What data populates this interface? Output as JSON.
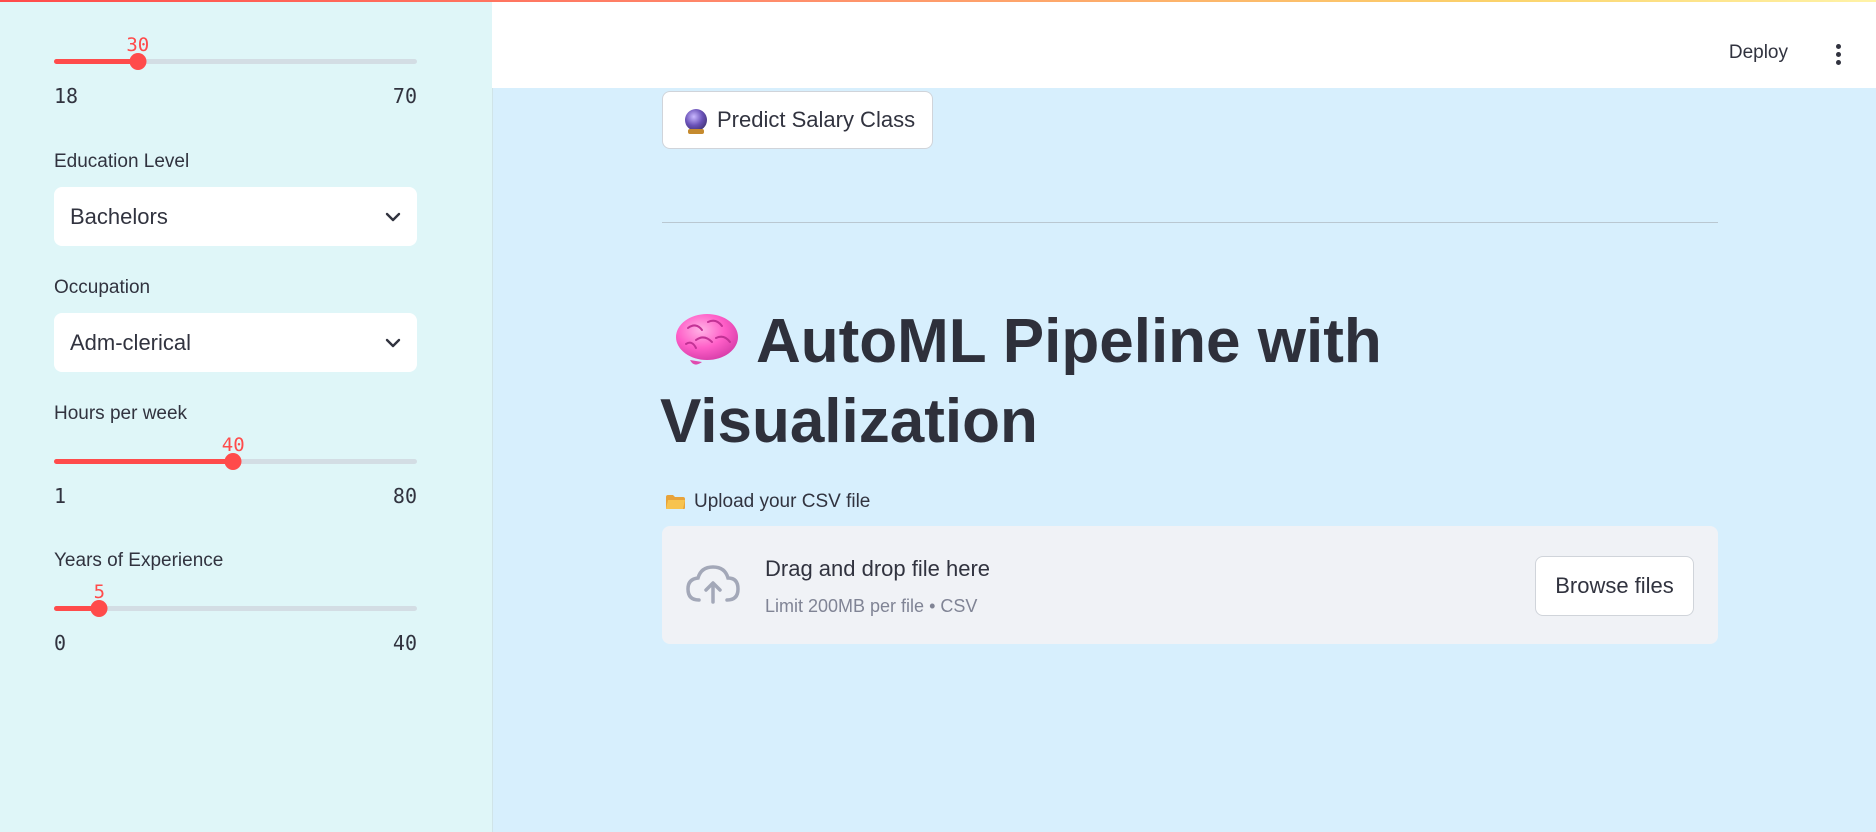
{
  "colors": {
    "accent": "#ff4b4b",
    "main_background": "#d7effd",
    "sidebar_background": "#dff6f8",
    "dropzone_background": "#f0f2f6",
    "text": "#31333f",
    "muted_text": "#808495"
  },
  "sidebar": {
    "age_slider": {
      "value": "30",
      "min": "18",
      "max": "70",
      "fraction": 0.2308
    },
    "education": {
      "label": "Education Level",
      "selected": "Bachelors"
    },
    "occupation": {
      "label": "Occupation",
      "selected": "Adm-clerical"
    },
    "hours_slider": {
      "label": "Hours per week",
      "value": "40",
      "min": "1",
      "max": "80",
      "fraction": 0.4937
    },
    "experience_slider": {
      "label": "Years of Experience",
      "value": "5",
      "min": "0",
      "max": "40",
      "fraction": 0.125
    }
  },
  "header": {
    "deploy_label": "Deploy",
    "menu_icon": "kebab-menu-icon"
  },
  "main": {
    "predict_button_label": "Predict Salary Class",
    "predict_icon": "crystal-ball-icon",
    "title_line1": "AutoML Pipeline with",
    "title_line2": "Visualization",
    "title_icon": "brain-icon",
    "upload": {
      "label": "Upload your CSV file",
      "label_icon": "folder-icon",
      "drop_title": "Drag and drop file here",
      "drop_sub": "Limit 200MB per file • CSV",
      "cloud_icon": "cloud-upload-icon",
      "browse_label": "Browse files"
    }
  }
}
